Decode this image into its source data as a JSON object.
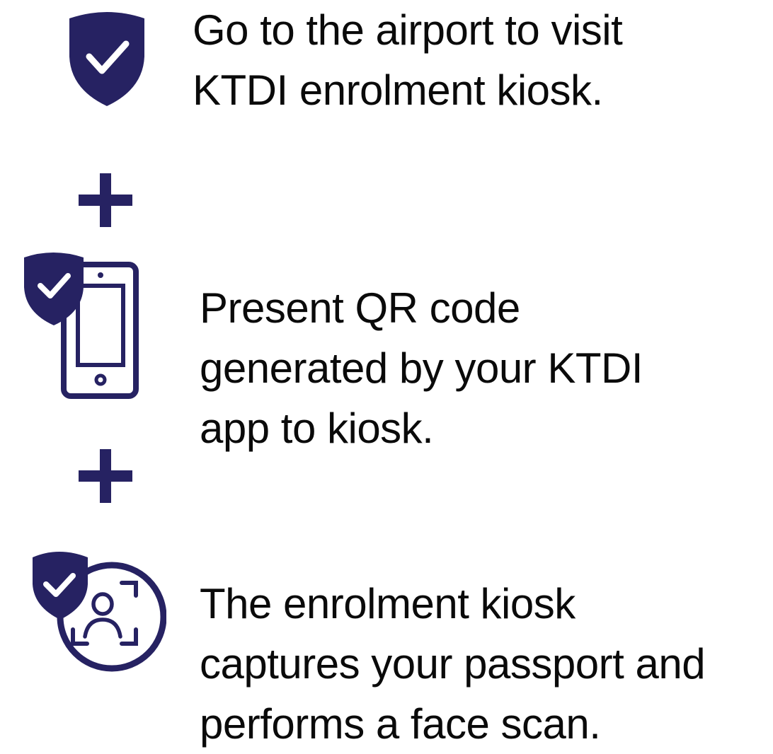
{
  "colors": {
    "icon_navy": "#262262",
    "text": "#0a0a0a",
    "background": "#ffffff"
  },
  "steps": [
    {
      "icon": "shield-check-icon",
      "lines": [
        "Go to the airport to visit",
        "KTDI enrolment kiosk."
      ]
    },
    {
      "icon": "phone-shield-check-icon",
      "lines": [
        "Present QR code",
        "generated by your KTDI",
        "app to kiosk."
      ]
    },
    {
      "icon": "face-scan-shield-check-icon",
      "lines": [
        "The enrolment kiosk",
        "captures your passport and",
        "performs a face scan."
      ]
    }
  ],
  "separators": [
    "plus-icon",
    "plus-icon"
  ]
}
